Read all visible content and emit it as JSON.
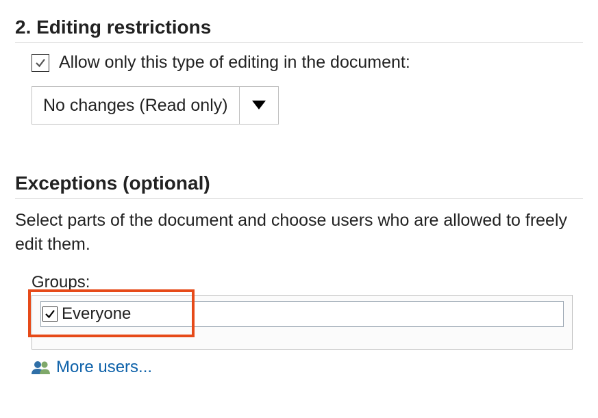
{
  "editingRestrictions": {
    "heading": "2. Editing restrictions",
    "allowOnlyLabel": "Allow only this type of editing in the document:",
    "dropdownValue": "No changes (Read only)"
  },
  "exceptions": {
    "heading": "Exceptions (optional)",
    "description": "Select parts of the document and choose users who are allowed to freely edit them.",
    "groupsLabel": "Groups:",
    "groupItem": "Everyone",
    "moreUsers": "More users..."
  }
}
